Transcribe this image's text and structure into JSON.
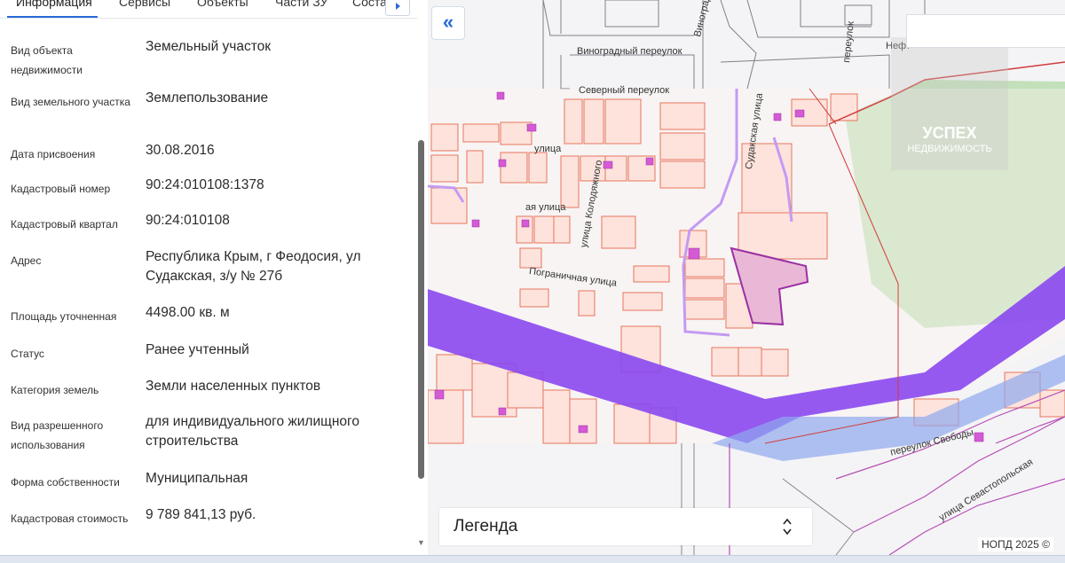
{
  "tabs": [
    "Информация",
    "Сервисы",
    "Объекты",
    "Части ЗУ",
    "Соста"
  ],
  "info_rows": [
    {
      "label": "Вид объекта недвижимости",
      "value": "Земельный участок"
    },
    {
      "label": "Вид земельного участка",
      "value": "Землепользование"
    },
    {
      "label": "Дата присвоения",
      "value": "30.08.2016"
    },
    {
      "label": "Кадастровый номер",
      "value": "90:24:010108:1378"
    },
    {
      "label": "Кадастровый квартал",
      "value": "90:24:010108"
    },
    {
      "label": "Адрес",
      "value": "Республика Крым, г Феодосия, ул Судакская, з/у № 27б"
    },
    {
      "label": "Площадь уточненная",
      "value": "4498.00 кв. м"
    },
    {
      "label": "Статус",
      "value": "Ранее учтенный"
    },
    {
      "label": "Категория земель",
      "value": "Земли населенных пунктов"
    },
    {
      "label": "Вид разрешенного использования",
      "value": "для индивидуального жилищного строительства"
    },
    {
      "label": "Форма собственности",
      "value": "Муниципальная"
    },
    {
      "label": "Кадастровая стоимость",
      "value": "9 789 841,13 руб."
    }
  ],
  "map": {
    "streets": [
      "Виноградный переулок",
      "Виноградная ул",
      "Северный переулок",
      "Судакская улица",
      "улица Колодяжного",
      "Пограничная улица",
      "переулок Свободы",
      "улица Севастопольская",
      "улица",
      "ая улица",
      "переулок"
    ],
    "partial_labels": [
      "Нефт"
    ],
    "legend_label": "Легенда",
    "copyright": "НОПД 2025 ©",
    "watermark_line1": "УСПЕХ",
    "watermark_line2": "НЕДВИЖИМОСТЬ",
    "colors": {
      "parcel_fill": "#fde3dc",
      "parcel_stroke": "#e8745c",
      "selected_fill": "#e9b8d6",
      "selected_stroke": "#9b2fa2",
      "zone_purple": "#8a48f0",
      "green": "#b9dcae"
    }
  }
}
